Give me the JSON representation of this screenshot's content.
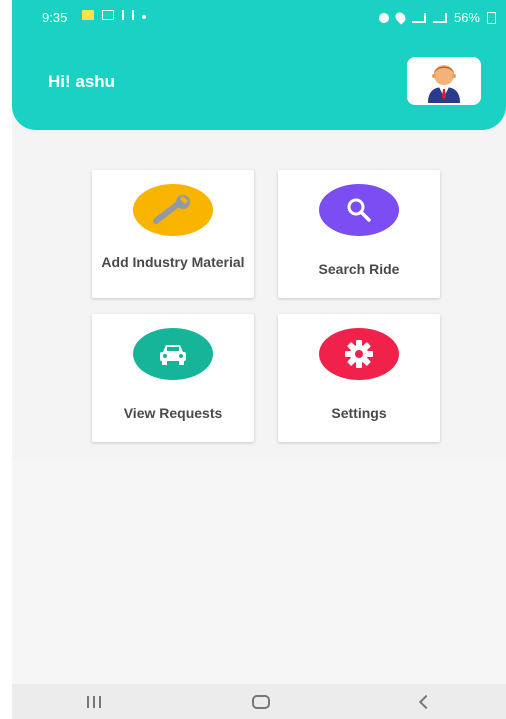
{
  "status_bar": {
    "time": "9:35",
    "battery": "56%"
  },
  "header": {
    "greeting": "Hi! ashu",
    "avatar_icon": "businessman-avatar-icon"
  },
  "tiles": [
    {
      "label": "Add Industry Material",
      "icon": "wrench-icon",
      "color": "#f9b400"
    },
    {
      "label": "Search Ride",
      "icon": "search-icon",
      "color": "#7c4df3"
    },
    {
      "label": "View Requests",
      "icon": "car-icon",
      "color": "#16b59a"
    },
    {
      "label": "Settings",
      "icon": "gear-icon",
      "color": "#f0214b"
    }
  ],
  "colors": {
    "header": "#1ad1c4",
    "background": "#f4f4f4"
  }
}
